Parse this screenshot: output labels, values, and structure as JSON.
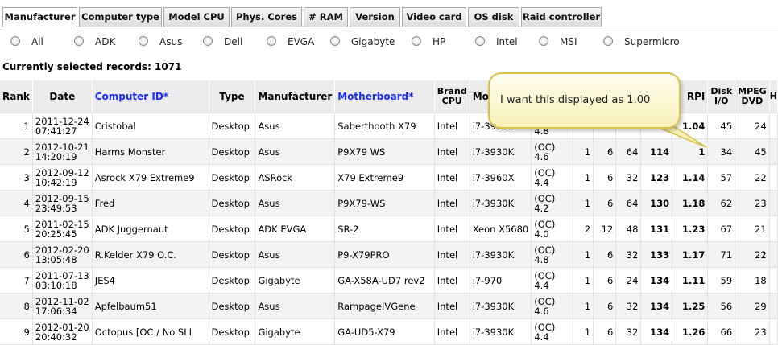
{
  "tabs": [
    "Manufacturer",
    "Computer type",
    "Model CPU",
    "Phys. Cores",
    "# RAM",
    "Version",
    "Video card",
    "OS disk",
    "Raid controller"
  ],
  "filters": [
    "All",
    "ADK",
    "Asus",
    "Dell",
    "EVGA",
    "Gigabyte",
    "HP",
    "Intel",
    "MSI",
    "Supermicro"
  ],
  "selected_records": "Currently selected records: 1071",
  "columns": {
    "rank": "Rank",
    "date": "Date",
    "computer_id": "Computer ID*",
    "type": "Type",
    "manufacturer": "Manufacturer",
    "motherboard": "Motherboard*",
    "brand_cpu_1": "Brand",
    "brand_cpu_2": "CPU",
    "model": "Mod",
    "rpi": "RPI",
    "disk_1": "Disk",
    "disk_2": "I/O",
    "mpeg_1": "MPEG",
    "mpeg_2": "DVD",
    "h": "H"
  },
  "rows": [
    {
      "rank": "1",
      "date1": "2011-12-24",
      "date2": "07:41:27",
      "id": "Cristobal",
      "type": "Desktop",
      "mfr": "Asus",
      "mb": "Saberthooth X79",
      "brand": "Intel",
      "model": "i7-3930K",
      "oc1": "",
      "oc2": "4.8",
      "c1": "",
      "c2": "",
      "c3": "",
      "score": "",
      "rpi": "1.04",
      "disk": "45",
      "mpeg": "24"
    },
    {
      "rank": "2",
      "date1": "2012-10-21",
      "date2": "14:20:19",
      "id": "Harms Monster",
      "type": "Desktop",
      "mfr": "Asus",
      "mb": "P9X79 WS",
      "brand": "Intel",
      "model": "i7-3930K",
      "oc1": "(OC)",
      "oc2": "4.6",
      "c1": "1",
      "c2": "6",
      "c3": "64",
      "score": "114",
      "rpi": "1",
      "disk": "34",
      "mpeg": "45"
    },
    {
      "rank": "3",
      "date1": "2012-09-12",
      "date2": "10:42:19",
      "id": "Asrock X79 Extreme9",
      "type": "Desktop",
      "mfr": "ASRock",
      "mb": "X79 Extreme9",
      "brand": "Intel",
      "model": "i7-3960X",
      "oc1": "(OC)",
      "oc2": "4.4",
      "c1": "1",
      "c2": "6",
      "c3": "32",
      "score": "123",
      "rpi": "1.14",
      "disk": "57",
      "mpeg": "22"
    },
    {
      "rank": "4",
      "date1": "2012-09-15",
      "date2": "23:49:53",
      "id": "Fred",
      "type": "Desktop",
      "mfr": "Asus",
      "mb": "P9X79-WS",
      "brand": "Intel",
      "model": "i7-3930K",
      "oc1": "(OC)",
      "oc2": "4.2",
      "c1": "1",
      "c2": "6",
      "c3": "64",
      "score": "130",
      "rpi": "1.18",
      "disk": "62",
      "mpeg": "23"
    },
    {
      "rank": "5",
      "date1": "2011-02-15",
      "date2": "20:25:45",
      "id": "ADK Juggernaut",
      "type": "Desktop",
      "mfr": "ADK EVGA",
      "mb": "SR-2",
      "brand": "Intel",
      "model": "Xeon X5680",
      "oc1": "(OC)",
      "oc2": "4.0",
      "c1": "2",
      "c2": "12",
      "c3": "48",
      "score": "131",
      "rpi": "1.23",
      "disk": "67",
      "mpeg": "21"
    },
    {
      "rank": "6",
      "date1": "2012-02-20",
      "date2": "13:05:48",
      "id": "R.Kelder X79 O.C.",
      "type": "Desktop",
      "mfr": "Asus",
      "mb": "P9-X79PRO",
      "brand": "Intel",
      "model": "i7-3930K",
      "oc1": "(OC)",
      "oc2": "4.8",
      "c1": "1",
      "c2": "6",
      "c3": "32",
      "score": "133",
      "rpi": "1.17",
      "disk": "71",
      "mpeg": "22"
    },
    {
      "rank": "7",
      "date1": "2011-07-13",
      "date2": "03:10:18",
      "id": "JES4",
      "type": "Desktop",
      "mfr": "Gigabyte",
      "mb": "GA-X58A-UD7 rev2",
      "brand": "Intel",
      "model": "i7-970",
      "oc1": "(OC)",
      "oc2": "4.4",
      "c1": "1",
      "c2": "6",
      "c3": "24",
      "score": "134",
      "rpi": "1.11",
      "disk": "59",
      "mpeg": "18"
    },
    {
      "rank": "8",
      "date1": "2012-11-02",
      "date2": "17:06:34",
      "id": "Apfelbaum51",
      "type": "Desktop",
      "mfr": "Asus",
      "mb": "RampageIVGene",
      "brand": "Intel",
      "model": "i7-3930K",
      "oc1": "(OC)",
      "oc2": "4.6",
      "c1": "1",
      "c2": "6",
      "c3": "32",
      "score": "134",
      "rpi": "1.25",
      "disk": "56",
      "mpeg": "29"
    },
    {
      "rank": "9",
      "date1": "2012-01-20",
      "date2": "20:40:32",
      "id": "Octopus [OC / No SLI",
      "type": "Desktop",
      "mfr": "Gigabyte",
      "mb": "GA-UD5-X79",
      "brand": "Intel",
      "model": "i7-3930K",
      "oc1": "(OC)",
      "oc2": "4.4",
      "c1": "1",
      "c2": "6",
      "c3": "32",
      "score": "134",
      "rpi": "1.26",
      "disk": "66",
      "mpeg": "23"
    }
  ],
  "callout": "I want this displayed as 1.00",
  "colors": {
    "link": "#1a2ef0",
    "callout_border": "#d8c24a",
    "callout_fill": "#f7f0b8"
  }
}
